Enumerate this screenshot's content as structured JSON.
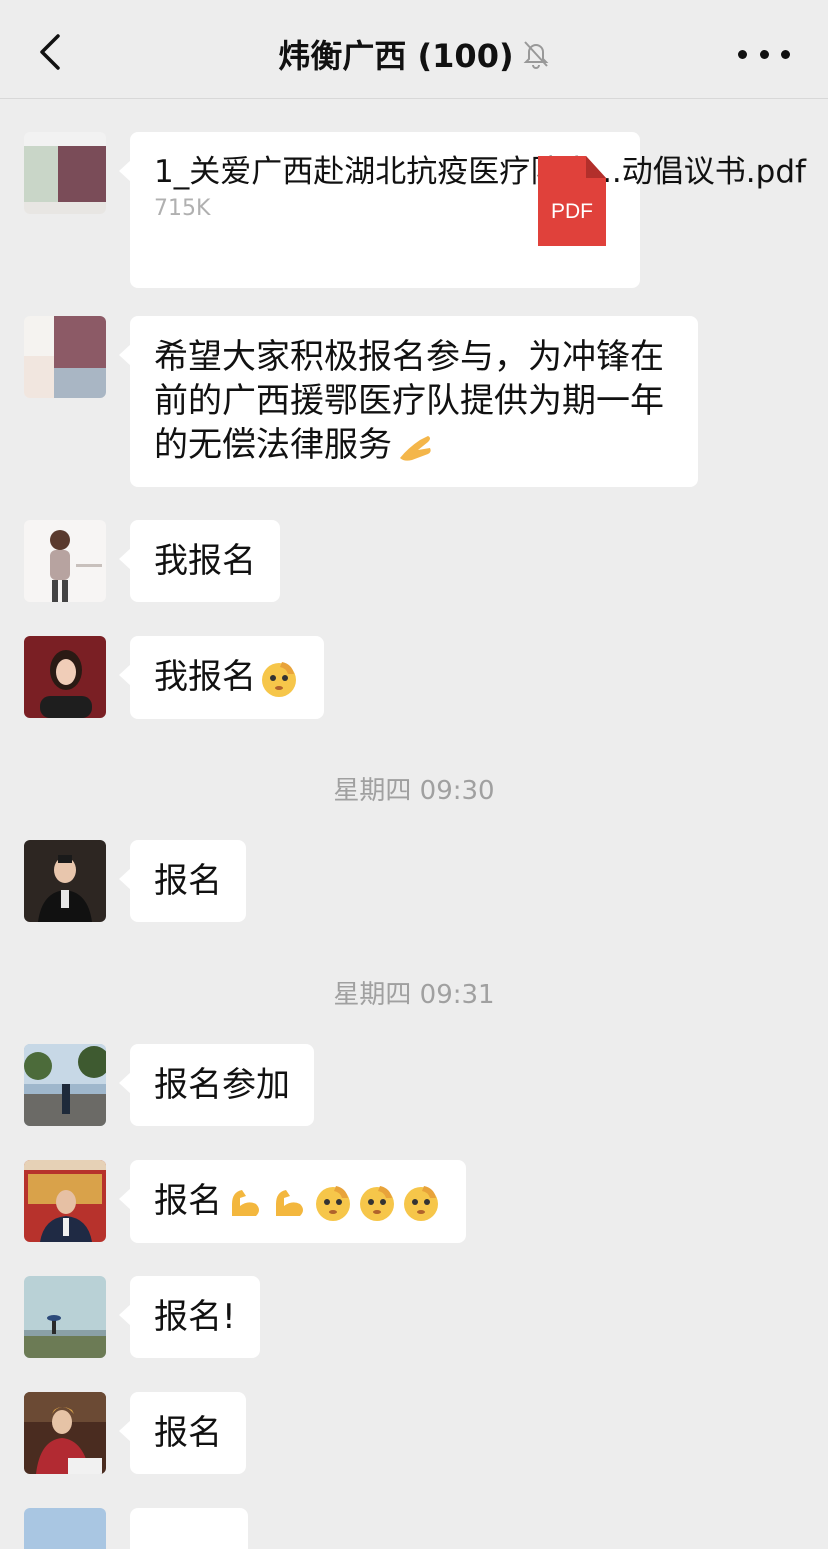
{
  "header": {
    "title": "炜衡广西 (100)",
    "back_icon": "chevron-left-icon",
    "mute_icon": "bell-off-icon",
    "more_icon": "ellipsis-icon"
  },
  "messages": [
    {
      "type": "file",
      "file_name": "1_关爱广西赴湖北抗疫医疗队人...动倡议书.pdf",
      "file_size": "715K",
      "file_badge": "PDF"
    },
    {
      "type": "text",
      "text": "希望大家积极报名参与，为冲锋在前的广西援鄂医疗队提供为期一年的无偿法律服务",
      "emoji": [
        "pinching-hand-emoji"
      ]
    },
    {
      "type": "text",
      "text": "我报名"
    },
    {
      "type": "text",
      "text": "我报名",
      "emoji": [
        "salute-face-emoji"
      ]
    },
    {
      "type": "time",
      "text": "星期四 09:30"
    },
    {
      "type": "text",
      "text": "报名"
    },
    {
      "type": "time",
      "text": "星期四 09:31"
    },
    {
      "type": "text",
      "text": "报名参加"
    },
    {
      "type": "text",
      "text": "报名",
      "emoji": [
        "flexed-biceps-emoji",
        "flexed-biceps-emoji",
        "salute-face-emoji",
        "salute-face-emoji",
        "salute-face-emoji"
      ]
    },
    {
      "type": "text",
      "text": "报名!"
    },
    {
      "type": "text",
      "text": "报名"
    }
  ],
  "colors": {
    "background": "#ededed",
    "bubble": "#ffffff",
    "pdf_red": "#e0413b",
    "timestamp": "#a0a0a0"
  }
}
